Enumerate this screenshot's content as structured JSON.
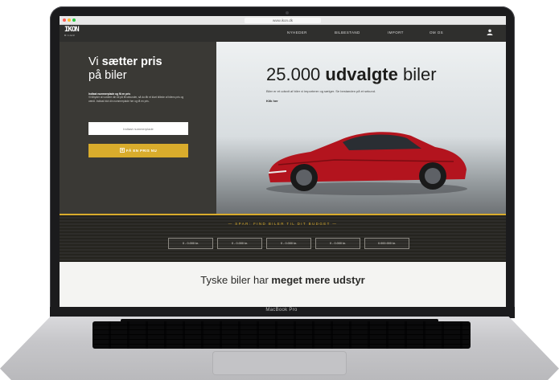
{
  "device": {
    "model_label": "MacBook Pro"
  },
  "browser": {
    "url": "www.ikon.dk"
  },
  "nav": {
    "logo_mark": "IKON",
    "logo_sub": "BILER",
    "items": [
      "NYHEDER",
      "BILBESTAND",
      "IMPORT",
      "OM OS"
    ]
  },
  "hero_left": {
    "title_pre": "Vi ",
    "title_bold": "sætter pris",
    "title_post": "på biler",
    "para_title": "Indtast nummerplade og få en pris",
    "para_body": "Vi tilbyder at vurdere din bil på få sekunder, så du får et klart billede af bilens pris og værdi. Indtast blot din nummerplade her og få en pris.",
    "input_placeholder": "Indtast nummerplade",
    "cta_label": "FÅ EN PRIS NU"
  },
  "hero_right": {
    "heading_num": "25.000 ",
    "heading_bold": "udvalgte",
    "heading_post": " biler",
    "sub": "Biler er et udsnit af biler vi importerer og sælger. Se bestanden på et sekund.",
    "link": "Klik her"
  },
  "price_strip": {
    "title": "— SPAR: FIND BILER TIL DIT BUDGET —",
    "buttons": [
      "0 - 0.000 kr.",
      "0 - 0.000 kr.",
      "0 - 0.000 kr.",
      "0 - 0.000 kr.",
      "0.000.000 kr."
    ]
  },
  "bottom": {
    "heading_pre": "Tyske biler har ",
    "heading_bold": "meget mere udstyr",
    "sub": ""
  },
  "colors": {
    "accent": "#d9ac2c",
    "dark_panel": "#3a3935",
    "car_red": "#b3141e"
  },
  "icons": [
    "logo-mark",
    "user-icon",
    "upload-icon"
  ]
}
